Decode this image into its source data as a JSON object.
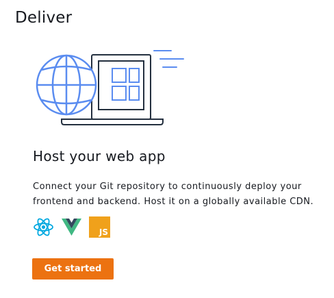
{
  "section": {
    "title": "Deliver"
  },
  "card": {
    "illustration": "globe-laptop-illustration",
    "title": "Host your web app",
    "description": "Connect your Git repository to continuously deploy your frontend and backend. Host it on a globally available CDN.",
    "frameworks": [
      {
        "name": "react-icon",
        "color": "#00a8e0"
      },
      {
        "name": "vue-icon",
        "colors": [
          "#41b883",
          "#34495e"
        ]
      },
      {
        "name": "javascript-icon",
        "text": "JS",
        "color": "#f0a11b"
      }
    ],
    "cta_label": "Get started"
  },
  "colors": {
    "accent": "#ec7211",
    "illustration_blue": "#5a8cf0",
    "illustration_dark": "#232f3e"
  }
}
